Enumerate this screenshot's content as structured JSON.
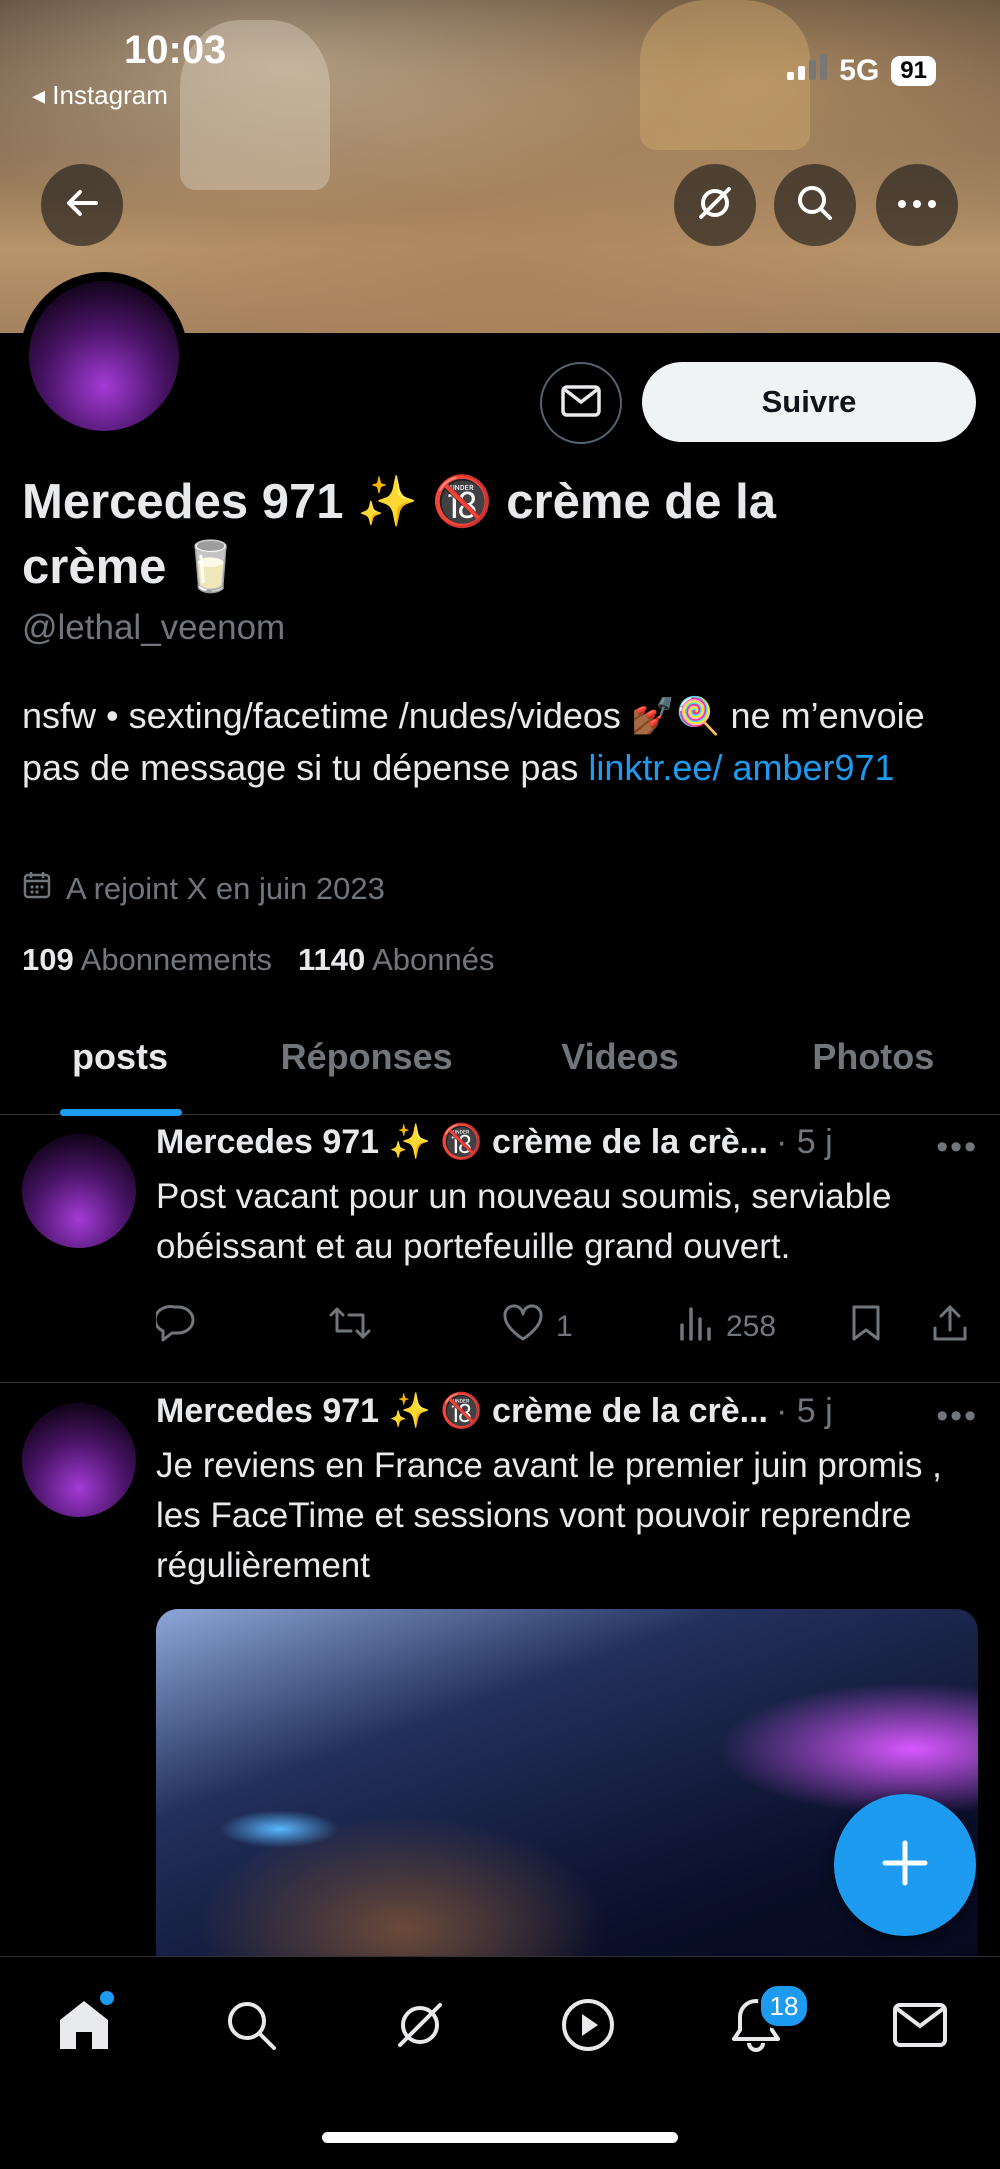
{
  "status_bar": {
    "time": "10:03",
    "back_app": "◂ Instagram",
    "network": "5G",
    "battery": "91"
  },
  "profile": {
    "name": "Mercedes 971 ✨ 🔞 crème de la crème 🥛",
    "handle": "@lethal_veenom",
    "bio_text": "nsfw • sexting/facetime /nudes/videos 💅🏾🍭 ne m’envoie pas de message si tu dépense pas ",
    "bio_link": "linktr.ee/ amber971",
    "joined": "A rejoint X en juin 2023",
    "following_count": "109",
    "following_label": "Abonnements",
    "followers_count": "1140",
    "followers_label": "Abonnés",
    "follow_label": "Suivre"
  },
  "tabs": [
    {
      "label": "posts"
    },
    {
      "label": "Réponses"
    },
    {
      "label": "Videos"
    },
    {
      "label": "Photos"
    }
  ],
  "posts": [
    {
      "author": "Mercedes 971 ✨ 🔞 crème de la crè...",
      "time": "· 5 j",
      "text": "Post vacant pour un nouveau soumis, serviable obéissant et au portefeuille grand ouvert.",
      "likes": "1",
      "views": "258"
    },
    {
      "author": "Mercedes 971 ✨ 🔞 crème de la crè...",
      "time": "· 5 j",
      "text": "Je reviens en France avant le premier juin promis , les FaceTime et sessions vont pouvoir reprendre régulièrement"
    }
  ],
  "nav": {
    "notifications_badge": "18"
  },
  "icons": [
    "back-arrow-icon",
    "grok-icon",
    "search-icon",
    "more-icon",
    "mail-icon",
    "calendar-icon",
    "reply-icon",
    "repost-icon",
    "like-icon",
    "views-icon",
    "bookmark-icon",
    "share-icon",
    "plus-icon",
    "home-icon",
    "play-icon",
    "bell-icon"
  ],
  "colors": {
    "accent": "#1d9bf0",
    "background": "#000000",
    "muted": "#71767b"
  }
}
